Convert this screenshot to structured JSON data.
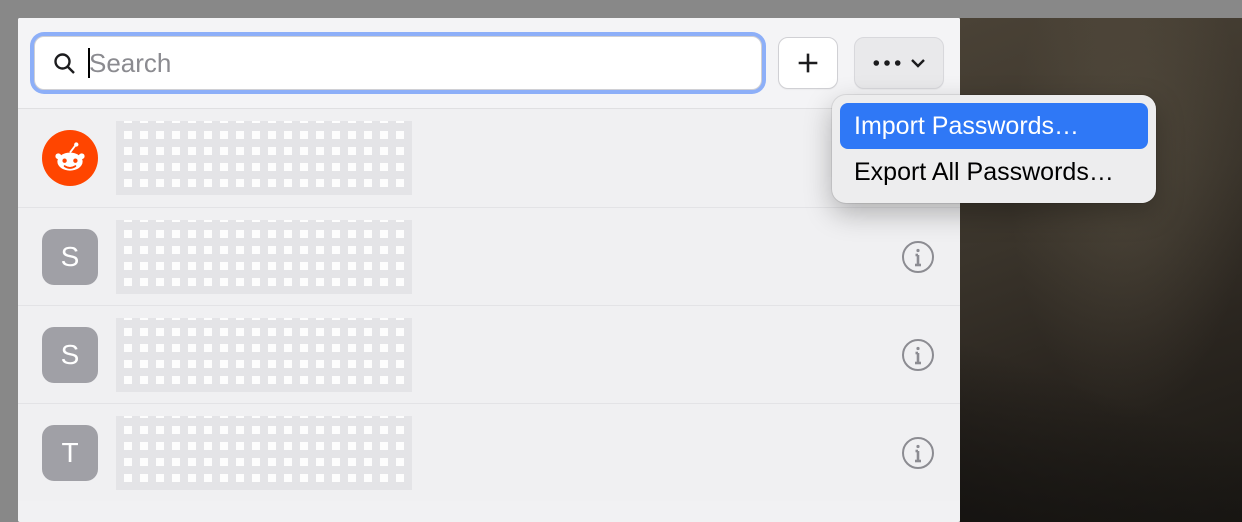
{
  "toolbar": {
    "search_placeholder": "Search",
    "search_value": ""
  },
  "dropdown": {
    "items": [
      {
        "label": "Import Passwords…",
        "selected": true
      },
      {
        "label": "Export All Passwords…",
        "selected": false
      }
    ]
  },
  "list": {
    "rows": [
      {
        "avatar_type": "reddit",
        "letter": "",
        "show_info": false
      },
      {
        "avatar_type": "letter",
        "letter": "S",
        "show_info": true
      },
      {
        "avatar_type": "letter",
        "letter": "S",
        "show_info": true
      },
      {
        "avatar_type": "letter",
        "letter": "T",
        "show_info": true
      }
    ]
  },
  "icons": {
    "search": "search-icon",
    "plus": "plus-icon",
    "more": "more-icon",
    "chevron_down": "chevron-down-icon",
    "info": "info-icon",
    "reddit": "reddit-icon"
  }
}
